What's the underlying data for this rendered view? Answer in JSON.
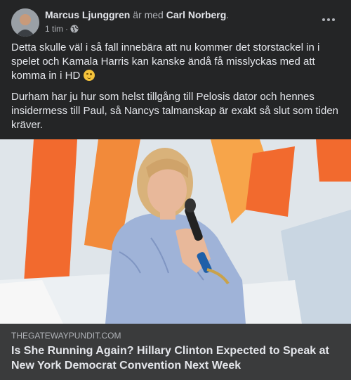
{
  "post": {
    "author": "Marcus Ljunggren",
    "with_text": " är med ",
    "tagged": "Carl Norberg",
    "period": ".",
    "time": "1 tim",
    "dot": "·",
    "paragraph1": "Detta skulle väl i så fall innebära att nu kommer det storstackel in i spelet och Kamala Harris kan kanske ändå få misslyckas med att komma in i HD",
    "paragraph2": "Durham har ju hur som helst tillgång till Pelosis dator och hennes insidermess till Paul, så Nancys talmanskap är exakt så slut som tiden kräver.",
    "emoji": "winking-face",
    "privacy_icon": "globe-icon",
    "menu_icon": "more-options-icon"
  },
  "link": {
    "domain": "THEGATEWAYPUNDIT.COM",
    "title": "Is She Running Again? Hillary Clinton Expected to Speak at New York Democrat Convention Next Week"
  },
  "colors": {
    "card_bg": "#242526",
    "text": "#e4e6eb",
    "secondary": "#b0b3b8",
    "preview_bg": "#3a3b3c"
  }
}
